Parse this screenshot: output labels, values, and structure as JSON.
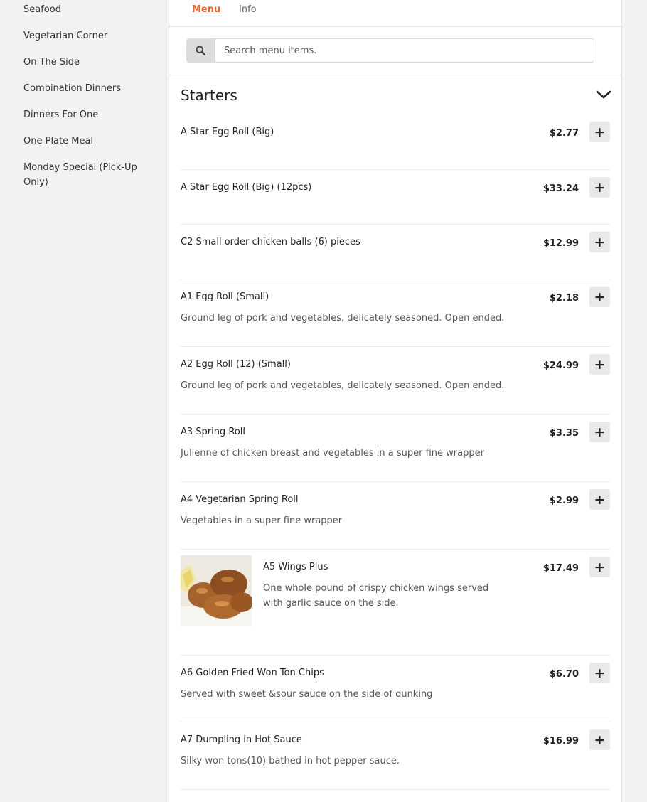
{
  "sidebar": {
    "items": [
      {
        "label": "Seafood"
      },
      {
        "label": "Vegetarian Corner"
      },
      {
        "label": "On The Side"
      },
      {
        "label": "Combination Dinners"
      },
      {
        "label": "Dinners For One"
      },
      {
        "label": "One Plate Meal"
      },
      {
        "label": "Monday Special (Pick-Up Only)"
      }
    ]
  },
  "tabs": [
    {
      "label": "Menu",
      "active": true
    },
    {
      "label": "Info",
      "active": false
    }
  ],
  "search": {
    "placeholder": "Search menu items.",
    "icon": "search-icon"
  },
  "section": {
    "title": "Starters",
    "icon": "chevron-down-icon"
  },
  "items": [
    {
      "name": "A Star Egg Roll (Big)",
      "price": "$2.77",
      "desc": ""
    },
    {
      "name": "A Star Egg Roll (Big) (12pcs)",
      "price": "$33.24",
      "desc": ""
    },
    {
      "name": "C2 Small order chicken balls (6) pieces",
      "price": "$12.99",
      "desc": ""
    },
    {
      "name": "A1 Egg Roll (Small)",
      "price": "$2.18",
      "desc": "Ground leg of pork and vegetables, delicately seasoned. Open ended."
    },
    {
      "name": "A2 Egg Roll (12) (Small)",
      "price": "$24.99",
      "desc": "Ground leg of pork and vegetables, delicately seasoned. Open ended."
    },
    {
      "name": "A3 Spring Roll",
      "price": "$3.35",
      "desc": "Julienne of chicken breast and vegetables in a super fine wrapper"
    },
    {
      "name": "A4 Vegetarian Spring Roll",
      "price": "$2.99",
      "desc": "Vegetables in a super fine wrapper"
    },
    {
      "name": "A5 Wings Plus",
      "price": "$17.49",
      "desc": "One whole pound of crispy chicken wings served with garlic sauce on the side."
    },
    {
      "name": "A6 Golden Fried Won Ton Chips",
      "price": "$6.70",
      "desc": "Served with sweet &sour sauce on the side of dunking"
    },
    {
      "name": "A7 Dumpling in Hot Sauce",
      "price": "$16.99",
      "desc": "Silky won tons(10) bathed in hot pepper sauce."
    }
  ],
  "add_label": "+",
  "colors": {
    "accent": "#e8652c",
    "background": "#f2f2f2",
    "panel": "#ffffff"
  }
}
